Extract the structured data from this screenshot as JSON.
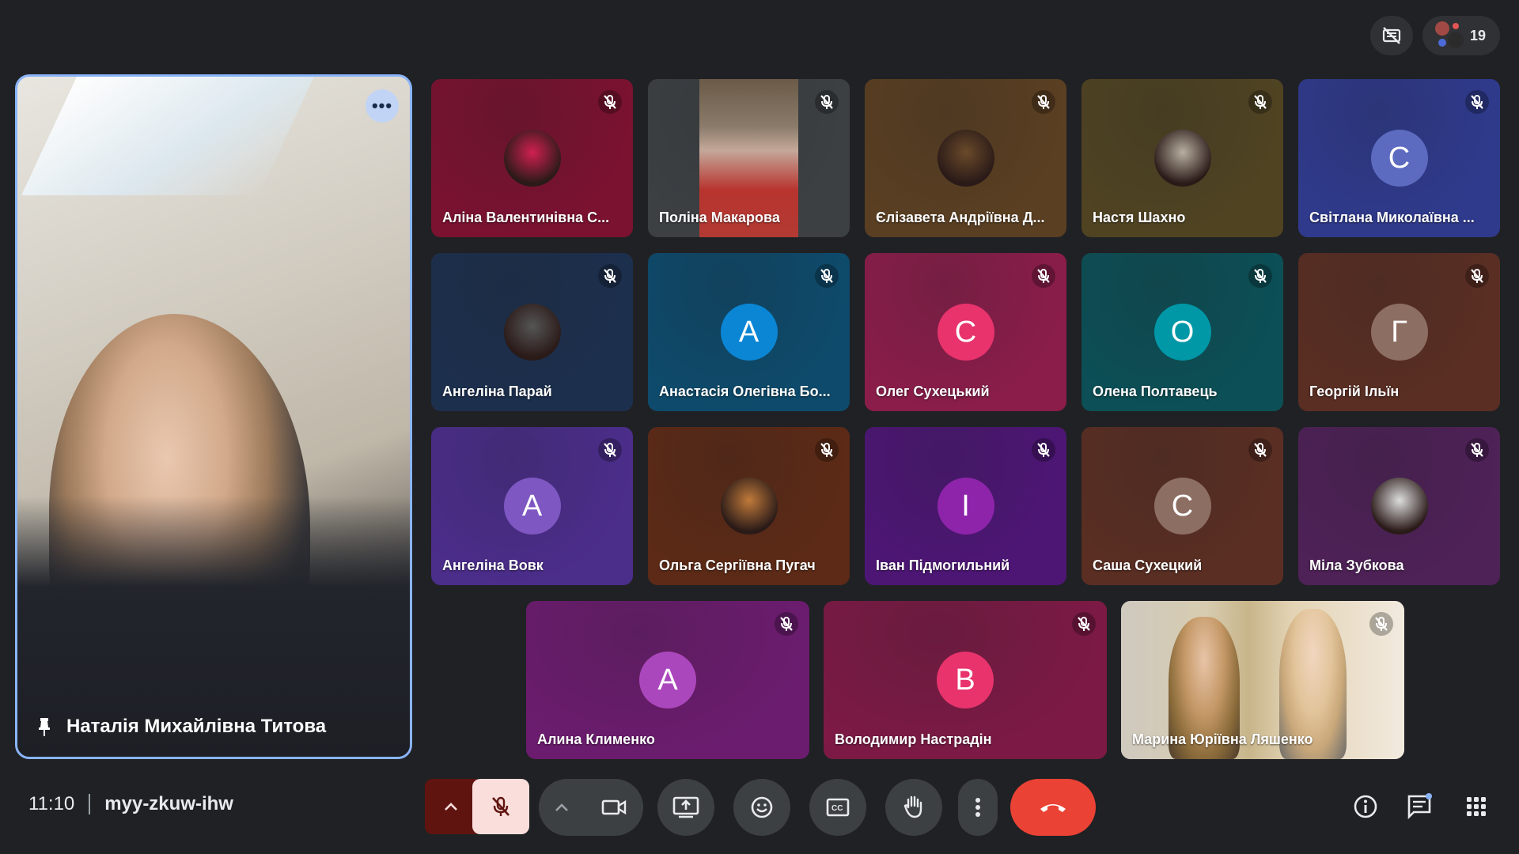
{
  "topbar": {
    "people_count": "19"
  },
  "main_speaker": {
    "name": "Наталія Михайлівна Титова"
  },
  "tiles": [
    {
      "name": "Аліна Валентинівна С...",
      "kind": "photo",
      "bg": "#7a1230",
      "accent": "#d02050"
    },
    {
      "name": "Поліна Макарова",
      "kind": "video",
      "bg": "#3c4043",
      "accent": "#d64545"
    },
    {
      "name": "Єлізавета Андріївна Д...",
      "kind": "photo",
      "bg": "#5a3f22",
      "accent": "#6a4a2a"
    },
    {
      "name": "Настя Шахно",
      "kind": "photo",
      "bg": "#4f4322",
      "accent": "#b8b0a0"
    },
    {
      "name": "Світлана Миколаївна ...",
      "kind": "letter",
      "letter": "С",
      "bg": "#2f3a8c",
      "accent": "#5c6bc0"
    },
    {
      "name": "Ангеліна Парай",
      "kind": "photo",
      "bg": "#1c2f4d",
      "accent": "#555"
    },
    {
      "name": "Анастасія Олегівна Бо...",
      "kind": "letter",
      "letter": "А",
      "bg": "#0e4a6b",
      "accent": "#0a86d4"
    },
    {
      "name": "Олег Сухецький",
      "kind": "letter",
      "letter": "С",
      "bg": "#8a1d4a",
      "accent": "#e8336c"
    },
    {
      "name": "Олена Полтавець",
      "kind": "letter",
      "letter": "О",
      "bg": "#0c4f56",
      "accent": "#0097a7"
    },
    {
      "name": "Георгій Ільїн",
      "kind": "letter",
      "letter": "Г",
      "bg": "#5a2e23",
      "accent": "#8d6e63"
    },
    {
      "name": "Ангеліна Вовк",
      "kind": "letter",
      "letter": "А",
      "bg": "#4b2d8a",
      "accent": "#7e57c2"
    },
    {
      "name": "Ольга Сергіївна Пугач",
      "kind": "photo",
      "bg": "#5c2a16",
      "accent": "#c07a3a"
    },
    {
      "name": "Іван Підмогильний",
      "kind": "letter",
      "letter": "І",
      "bg": "#4d1675",
      "accent": "#8e24aa"
    },
    {
      "name": "Саша Сухецкий",
      "kind": "letter",
      "letter": "С",
      "bg": "#5a2e23",
      "accent": "#8d6e63"
    },
    {
      "name": "Міла Зубкова",
      "kind": "photo",
      "bg": "#4e2157",
      "accent": "#ddd"
    },
    {
      "name": "Алина Клименко",
      "kind": "letter",
      "letter": "А",
      "bg": "#6b1c6e",
      "accent": "#ab47bc"
    },
    {
      "name": "Володимир Настрадін",
      "kind": "letter",
      "letter": "В",
      "bg": "#7c1a45",
      "accent": "#e8336c"
    },
    {
      "name": "Марина Юріївна Ляшенко",
      "kind": "video",
      "bg": "#cfcac0",
      "accent": "#d9a33d"
    }
  ],
  "bottom": {
    "time": "11:10",
    "meeting_code": "myy-zkuw-ihw"
  },
  "colors": {
    "bg": "#202124",
    "end_call": "#ea4335",
    "mic_off_bg": "#f9dedc",
    "mic_chevron_bg": "#601410",
    "active_border": "#8ab4f8"
  }
}
